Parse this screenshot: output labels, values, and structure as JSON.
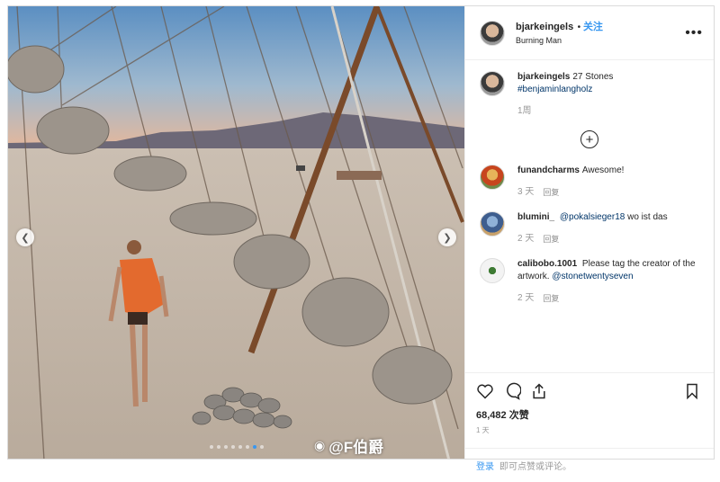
{
  "post": {
    "username": "bjarkeingels",
    "follow_label": "关注",
    "location": "Burning Man",
    "more_label": "•••"
  },
  "caption": {
    "username": "bjarkeingels",
    "text": "27 Stones",
    "hashtag": "#benjaminlangholz",
    "time": "1周"
  },
  "comments": [
    {
      "username": "funandcharms",
      "prefix": "",
      "mention": "",
      "text": "Awesome!",
      "time": "3 天",
      "reply": "回复"
    },
    {
      "username": "blumini_",
      "prefix": "",
      "mention": "@pokalsieger18",
      "text": "wo ist das",
      "time": "2 天",
      "reply": "回复"
    },
    {
      "username": "calibobo.1001",
      "prefix": "Please tag the creator of the artwork.",
      "mention": "@stonetwentyseven",
      "text": "",
      "time": "2 天",
      "reply": "回复"
    }
  ],
  "likes": "68,482 次赞",
  "time_ago": "1 天",
  "add_comment": {
    "login_label": "登录",
    "placeholder": "即可点赞或评论。"
  },
  "watermark": "@F伯爵",
  "carousel": {
    "count": 8,
    "active_index": 6
  },
  "colors": {
    "link": "#3897f0",
    "border": "#dbdbdb",
    "muted": "#999999"
  },
  "icons": [
    "heart-icon",
    "comment-icon",
    "share-icon",
    "bookmark-icon",
    "plus-circle-icon",
    "chevron-left-icon",
    "chevron-right-icon",
    "more-icon",
    "weibo-icon"
  ]
}
